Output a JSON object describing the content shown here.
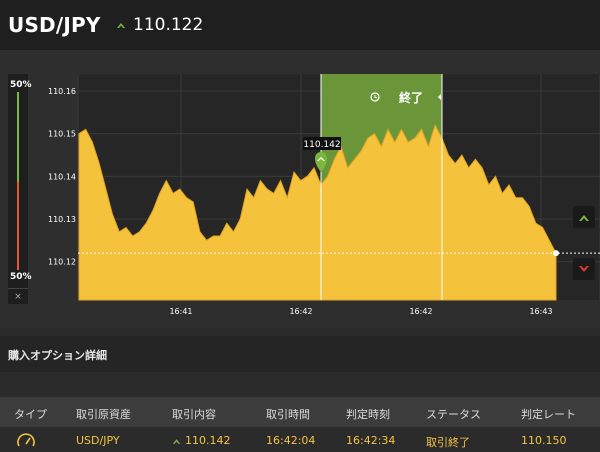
{
  "header": {
    "pair": "USD/JPY",
    "rate": "110.122",
    "trend": "up"
  },
  "meter": {
    "top_label": "50%",
    "bottom_label": "50%",
    "close_label": "×"
  },
  "chart": {
    "y_ticks": [
      "110.16",
      "110.15",
      "110.14",
      "110.13",
      "110.12"
    ],
    "x_ticks": [
      "16:41",
      "16:42",
      "16:42",
      "16:43"
    ],
    "entry_marker_label": "110.142",
    "end_zone_label": "終了",
    "colors": {
      "area": "#f5c33b",
      "zone": "#6e9c3a",
      "marker": "#7ab640",
      "low": "#e23b2e"
    }
  },
  "section": {
    "title": "購入オプション詳細"
  },
  "table": {
    "headers": [
      "タイプ",
      "取引原資産",
      "取引内容",
      "取引時間",
      "判定時刻",
      "ステータス",
      "判定レート"
    ],
    "row": {
      "asset": "USD/JPY",
      "content": "110.142",
      "trade_time": "16:42:04",
      "judge_time": "16:42:34",
      "status": "取引終了",
      "judge_rate": "110.150"
    }
  },
  "chart_data": {
    "type": "area",
    "title": "",
    "xlabel": "",
    "ylabel": "",
    "ylim": [
      110.111,
      110.164
    ],
    "x_ticks": [
      "16:41",
      "16:42",
      "16:42",
      "16:43"
    ],
    "series": [
      {
        "values": [
          110.15,
          110.151,
          110.148,
          110.143,
          110.137,
          110.131,
          110.127,
          110.128,
          110.126,
          110.127,
          110.129,
          110.132,
          110.136,
          110.139,
          110.136,
          110.137,
          110.135,
          110.134,
          110.127,
          110.125,
          110.126,
          110.126,
          110.129,
          110.127,
          110.13,
          110.137,
          110.135,
          110.139,
          110.137,
          110.136,
          110.139,
          110.135,
          110.141,
          110.139,
          110.14,
          110.142,
          110.138,
          110.14,
          110.144,
          110.147,
          110.142,
          110.144,
          110.146,
          110.149,
          110.15,
          110.147,
          110.151,
          110.148,
          110.151,
          110.148,
          110.149,
          110.151,
          110.147,
          110.152,
          110.149,
          110.145,
          110.143,
          110.145,
          110.142,
          110.144,
          110.142,
          110.138,
          110.14,
          110.136,
          110.138,
          110.135,
          110.135,
          110.133,
          110.129,
          110.128,
          110.125,
          110.122
        ]
      }
    ],
    "current_rate": 110.122,
    "entry_rate": 110.142
  }
}
